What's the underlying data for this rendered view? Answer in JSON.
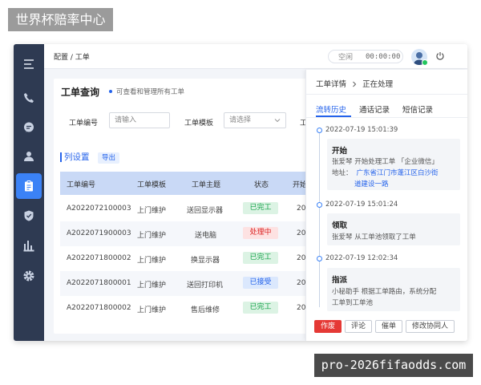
{
  "watermark_top": "世界杯赔率中心",
  "watermark_bottom": "pro-2026fifaodds.com",
  "topbar": {
    "breadcrumb": "配置 / 工单",
    "status": "空闲",
    "timer": "00:00:00"
  },
  "main": {
    "title": "工单查询",
    "subtitle": "可查看和管理所有工单",
    "filters": [
      {
        "label": "工单编号",
        "placeholder": "请输入"
      },
      {
        "label": "工单模板",
        "placeholder": "请选择"
      },
      {
        "label": "工"
      }
    ],
    "column_settings": "列设置",
    "export": "导出",
    "columns": [
      "工单编号",
      "工单模板",
      "工单主题",
      "状态",
      "开始"
    ],
    "rows": [
      {
        "id": "A2022072100003",
        "template": "上门维护",
        "subject": "送回显示器",
        "status": "已完工",
        "status_type": "done",
        "start": "20"
      },
      {
        "id": "A2022071900003",
        "template": "上门维护",
        "subject": "送电脑",
        "status": "处理中",
        "status_type": "proc",
        "start": "20"
      },
      {
        "id": "A2022071800002",
        "template": "上门维护",
        "subject": "换显示器",
        "status": "已完工",
        "status_type": "done",
        "start": "20"
      },
      {
        "id": "A2022071800001",
        "template": "上门维护",
        "subject": "送回打印机",
        "status": "已接受",
        "status_type": "acc",
        "start": "20"
      },
      {
        "id": "A2022071800002",
        "template": "上门维护",
        "subject": "售后维修",
        "status": "已完工",
        "status_type": "done",
        "start": "20"
      }
    ]
  },
  "panel": {
    "title": "工单详情",
    "state": "正在处理",
    "tabs": [
      "流转历史",
      "通话记录",
      "短信记录"
    ],
    "timeline": [
      {
        "time": "2022-07-19  15:01:39",
        "heading": "开始",
        "lines": [
          "张爱琴  开始处理工单 「企业微信」"
        ],
        "address_label": "地址：",
        "address_lines": [
          "广东省江门市蓬江区白沙街",
          "道建设一路"
        ]
      },
      {
        "time": "2022-07-19  15:01:24",
        "heading": "领取",
        "lines": [
          "张爱琴  从工单池领取了工单"
        ]
      },
      {
        "time": "2022-07-19  12:02:34",
        "heading": "指派",
        "lines": [
          "小秘助手  根据工单路由，系统分配",
          "工单到工单池"
        ]
      }
    ],
    "actions": [
      "作废",
      "评论",
      "催单",
      "修改协同人"
    ]
  },
  "colors": {
    "accent": "#2563eb",
    "sidebar": "#2e3a52",
    "danger": "#e53935",
    "success": "#16a34a"
  },
  "icons": [
    "menu-icon",
    "phone-icon",
    "chat-icon",
    "user-icon",
    "clipboard-icon",
    "shield-icon",
    "chart-icon",
    "gear-icon",
    "power-icon",
    "chevron-down-icon",
    "chevron-right-icon"
  ]
}
